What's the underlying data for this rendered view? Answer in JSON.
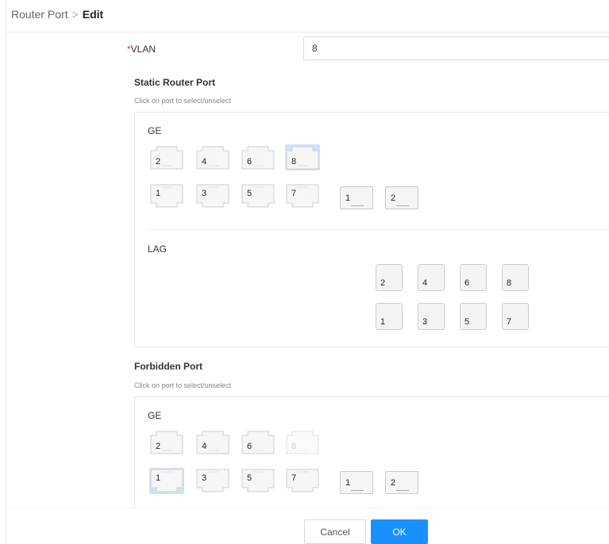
{
  "breadcrumb": {
    "parent": "Router Port",
    "separator": ">",
    "current": "Edit"
  },
  "vlan": {
    "required_mark": "*",
    "label": "VLAN",
    "value": "8"
  },
  "static_section": {
    "title": "Static Router Port",
    "hint": "Click on port to select/unselect",
    "ge_label": "GE",
    "lag_label": "LAG",
    "ge_top_ports": [
      {
        "label": "2",
        "selected": false,
        "disabled": false
      },
      {
        "label": "4",
        "selected": false,
        "disabled": false
      },
      {
        "label": "6",
        "selected": false,
        "disabled": false
      },
      {
        "label": "8",
        "selected": true,
        "disabled": false
      }
    ],
    "ge_bottom_ports": [
      {
        "label": "1",
        "selected": false,
        "disabled": false
      },
      {
        "label": "3",
        "selected": false,
        "disabled": false
      },
      {
        "label": "5",
        "selected": false,
        "disabled": false
      },
      {
        "label": "7",
        "selected": false,
        "disabled": false
      }
    ],
    "sfp_ports": [
      "1",
      "2"
    ],
    "lag_top": [
      "2",
      "4",
      "6",
      "8"
    ],
    "lag_bottom": [
      "1",
      "3",
      "5",
      "7"
    ]
  },
  "forbidden_section": {
    "title": "Forbidden Port",
    "hint": "Click on port to select/unselect",
    "ge_label": "GE",
    "ge_top_ports": [
      {
        "label": "2",
        "selected": false,
        "disabled": false
      },
      {
        "label": "4",
        "selected": false,
        "disabled": false
      },
      {
        "label": "6",
        "selected": false,
        "disabled": false
      },
      {
        "label": "8",
        "selected": false,
        "disabled": true
      }
    ],
    "ge_bottom_ports": [
      {
        "label": "1",
        "selected": true,
        "disabled": false
      },
      {
        "label": "3",
        "selected": false,
        "disabled": false
      },
      {
        "label": "5",
        "selected": false,
        "disabled": false
      },
      {
        "label": "7",
        "selected": false,
        "disabled": false
      }
    ],
    "sfp_ports": [
      "1",
      "2"
    ]
  },
  "footer": {
    "cancel_label": "Cancel",
    "ok_label": "OK"
  },
  "colors": {
    "accent": "#1890ff",
    "selected_port": "#cfe2fb",
    "required": "#e0322e"
  }
}
